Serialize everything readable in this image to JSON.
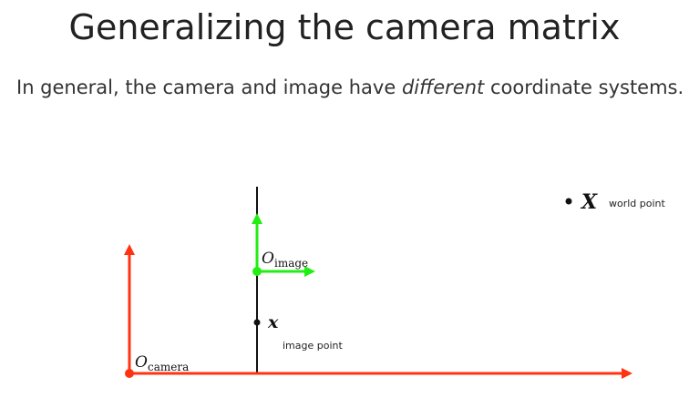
{
  "slide": {
    "title": "Generalizing the camera matrix",
    "subtitle": {
      "before": "In general, the camera and image have ",
      "emphasis": "different",
      "after": " coordinate systems."
    }
  },
  "diagram": {
    "camera_origin": {
      "symbol": "O",
      "subscript": "camera"
    },
    "image_origin": {
      "symbol": "O",
      "subscript": "image"
    },
    "image_point": {
      "symbol": "x",
      "label": "image point"
    },
    "world_point": {
      "symbol": "X",
      "label": "world point"
    },
    "colors": {
      "camera_axes": "#ff3311",
      "image_axes": "#22ee11",
      "image_plane": "#111111",
      "points": "#111111"
    },
    "icons": {
      "camera-origin-dot": "filled-circle",
      "image-origin-dot": "filled-circle",
      "point-dot": "filled-circle"
    }
  }
}
